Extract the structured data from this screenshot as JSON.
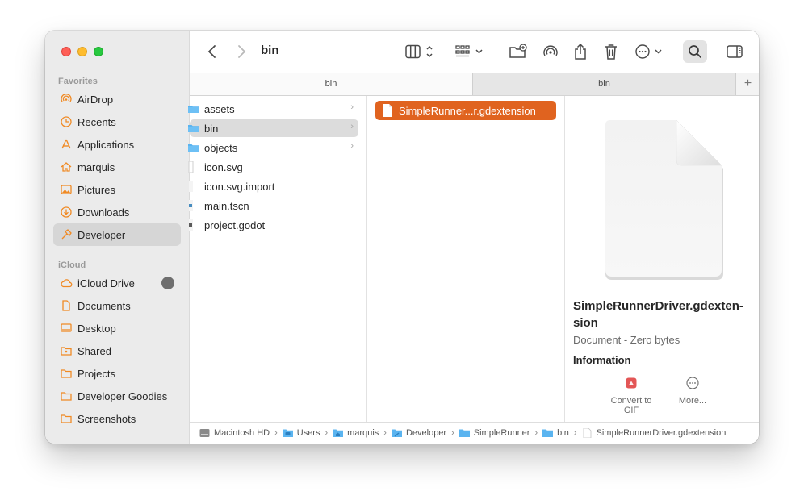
{
  "window": {
    "title": "bin"
  },
  "sidebar": {
    "favorites_label": "Favorites",
    "favorites": [
      {
        "label": "AirDrop",
        "icon": "airdrop-icon"
      },
      {
        "label": "Recents",
        "icon": "clock-icon"
      },
      {
        "label": "Applications",
        "icon": "applications-icon"
      },
      {
        "label": "marquis",
        "icon": "home-icon"
      },
      {
        "label": "Pictures",
        "icon": "photo-icon"
      },
      {
        "label": "Downloads",
        "icon": "download-icon"
      },
      {
        "label": "Developer",
        "icon": "hammer-icon",
        "selected": true
      }
    ],
    "icloud_label": "iCloud",
    "icloud": [
      {
        "label": "iCloud Drive",
        "icon": "cloud-icon"
      },
      {
        "label": "Documents",
        "icon": "document-icon"
      },
      {
        "label": "Desktop",
        "icon": "desktop-icon"
      },
      {
        "label": "Shared",
        "icon": "shared-folder-icon"
      },
      {
        "label": "Projects",
        "icon": "folder-icon"
      },
      {
        "label": "Developer Goodies",
        "icon": "folder-icon"
      },
      {
        "label": "Screenshots",
        "icon": "folder-icon"
      }
    ],
    "accent_color": "#f08a24"
  },
  "tabs": [
    {
      "label": "bin",
      "active": true
    },
    {
      "label": "bin",
      "active": false
    }
  ],
  "tab_add_label": "+",
  "column1": [
    {
      "label": "assets",
      "type": "folder",
      "chevron": "›"
    },
    {
      "label": "bin",
      "type": "folder",
      "chevron": "›",
      "selected": true
    },
    {
      "label": "objects",
      "type": "folder",
      "chevron": "›"
    },
    {
      "label": "icon.svg",
      "type": "file"
    },
    {
      "label": "icon.svg.import",
      "type": "file"
    },
    {
      "label": "main.tscn",
      "type": "file"
    },
    {
      "label": "project.godot",
      "type": "file"
    }
  ],
  "column2": {
    "selected_label": "SimpleRunner...r.gdextension"
  },
  "preview": {
    "name": "SimpleRunnerDriver.gdexten-sion",
    "name_line1": "SimpleRunnerDriver.gdexten-",
    "name_line2": "sion",
    "kind": "Document - Zero bytes",
    "info_label": "Information",
    "actions": [
      {
        "label": "Convert to GIF",
        "line1": "Convert to",
        "line2": "GIF",
        "icon": "convert-gif-icon"
      },
      {
        "label": "More...",
        "line1": "More...",
        "line2": "",
        "icon": "more-icon"
      }
    ]
  },
  "pathbar": [
    {
      "label": "Macintosh HD",
      "icon": "disk-icon"
    },
    {
      "label": "Users",
      "icon": "folder-icon"
    },
    {
      "label": "marquis",
      "icon": "home-folder-icon"
    },
    {
      "label": "Developer",
      "icon": "developer-folder-icon"
    },
    {
      "label": "SimpleRunner",
      "icon": "folder-icon"
    },
    {
      "label": "bin",
      "icon": "folder-icon"
    },
    {
      "label": "SimpleRunnerDriver.gdextension",
      "icon": "file-icon"
    }
  ],
  "path_separator": "›",
  "colors": {
    "selection_orange": "#e0631f",
    "folder_blue": "#5ab4f0"
  }
}
